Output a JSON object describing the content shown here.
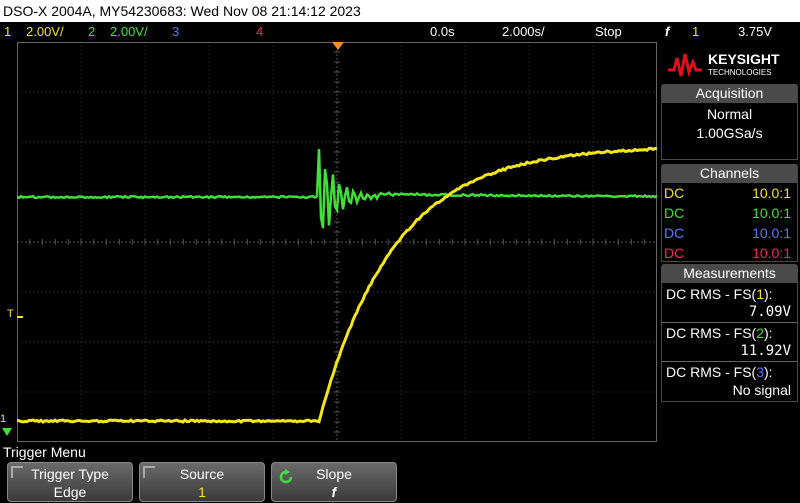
{
  "title": "DSO-X 2004A, MY54230683: Wed Nov 08 21:14:12 2023",
  "status": {
    "ch1_num": "1",
    "ch1_scale": "2.00V/",
    "ch2_num": "2",
    "ch2_scale": "2.00V/",
    "ch3_num": "3",
    "ch4_num": "4",
    "time_pos": "0.0s",
    "time_scale": "2.000s/",
    "run_state": "Stop",
    "trig_icon": "rising-edge-icon",
    "trig_symbol": "f",
    "trig_ch": "1",
    "trig_level": "3.75V"
  },
  "logo": {
    "brand": "KEYSIGHT",
    "sub": "TECHNOLOGIES"
  },
  "acquisition": {
    "head": "Acquisition",
    "mode": "Normal",
    "rate": "1.00GSa/s"
  },
  "channels": {
    "head": "Channels",
    "rows": [
      {
        "coupling": "DC",
        "probe": "10.0:1",
        "color": "#f5e61a"
      },
      {
        "coupling": "DC",
        "probe": "10.0:1",
        "color": "#3ee03a"
      },
      {
        "coupling": "DC",
        "probe": "10.0:1",
        "color": "#5a78ff"
      },
      {
        "coupling": "DC",
        "probe": "10.0:1",
        "color": "#ff1f6a"
      }
    ]
  },
  "measurements": {
    "head": "Measurements",
    "items": [
      {
        "label": "DC RMS - FS(",
        "ch": "1",
        "close": "):",
        "value": "7.09V",
        "color": "#f5e61a"
      },
      {
        "label": "DC RMS - FS(",
        "ch": "2",
        "close": "):",
        "value": "11.92V",
        "color": "#3ee03a"
      },
      {
        "label": "DC RMS - FS(",
        "ch": "3",
        "close": "):",
        "value": "No signal",
        "color": "#5a78ff"
      }
    ]
  },
  "menu": {
    "label": "Trigger Menu",
    "softkeys": [
      {
        "title": "Trigger Type",
        "value": "Edge"
      },
      {
        "title": "Source",
        "value": "1"
      },
      {
        "title": "Slope",
        "value": "f",
        "icon": "slope-cycle-icon"
      }
    ]
  },
  "markers": {
    "trigger_level": "T",
    "ch1_ground": "1"
  }
}
